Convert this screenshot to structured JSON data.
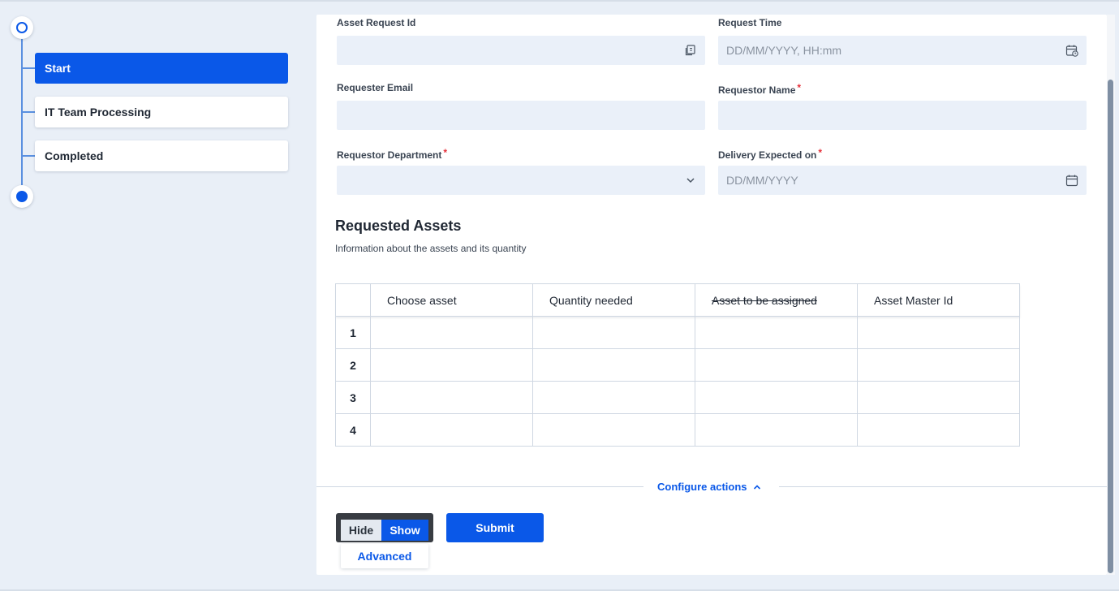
{
  "stepper": {
    "steps": [
      {
        "label": "Start",
        "active": true
      },
      {
        "label": "IT Team Processing",
        "active": false
      },
      {
        "label": "Completed",
        "active": false
      }
    ]
  },
  "form": {
    "asset_request_id": {
      "label": "Asset Request Id",
      "value": "",
      "icon": "copy-icon"
    },
    "request_time": {
      "label": "Request Time",
      "placeholder": "DD/MM/YYYY, HH:mm",
      "icon": "calendar-clock-icon"
    },
    "requester_email": {
      "label": "Requester Email",
      "value": ""
    },
    "requestor_name": {
      "label": "Requestor Name",
      "required_mark": "*",
      "value": ""
    },
    "requestor_department": {
      "label": "Requestor Department",
      "required_mark": "*",
      "value": "",
      "icon": "chevron-down-icon"
    },
    "delivery_expected_on": {
      "label": "Delivery Expected on",
      "required_mark": "*",
      "placeholder": "DD/MM/YYYY",
      "icon": "calendar-icon"
    }
  },
  "assets": {
    "title": "Requested Assets",
    "subtitle": "Information about the assets and its quantity",
    "columns": [
      "Choose asset",
      "Quantity needed",
      "Asset to be assigned",
      "Asset Master Id"
    ],
    "rows": [
      {
        "num": "1"
      },
      {
        "num": "2"
      },
      {
        "num": "3"
      },
      {
        "num": "4"
      }
    ]
  },
  "actions": {
    "configure_label": "Configure actions",
    "toggle_hide": "Hide",
    "toggle_show": "Show",
    "advanced": "Advanced",
    "submit": "Submit"
  },
  "colors": {
    "accent": "#0a58e8",
    "background": "#e9eff7",
    "input_bg": "#eaf0f9",
    "required": "#e5303a"
  }
}
